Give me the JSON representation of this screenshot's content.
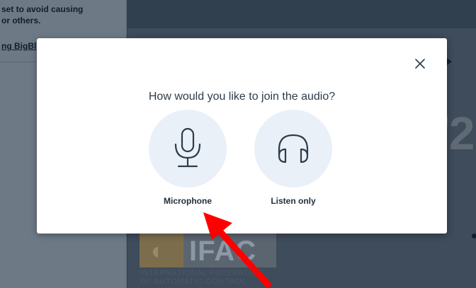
{
  "chat": {
    "line1": "set to avoid causing",
    "line2": "or others.",
    "link": "ng BigBl"
  },
  "background": {
    "slide_digit": "'2",
    "logo_text": "IFAC",
    "logo_caption_1": "INTERNATIONAL FEDERATION",
    "logo_caption_2": "OF AUTOMATIC CONTROL"
  },
  "modal": {
    "title": "How would you like to join the audio?",
    "options": [
      {
        "label": "Microphone",
        "icon": "microphone-icon"
      },
      {
        "label": "Listen only",
        "icon": "headphones-icon"
      }
    ],
    "close_icon": "close-icon"
  },
  "colors": {
    "icon_stroke": "#2d3c4a",
    "option_bg": "#eaf0f8",
    "pointer": "#ff0000"
  }
}
